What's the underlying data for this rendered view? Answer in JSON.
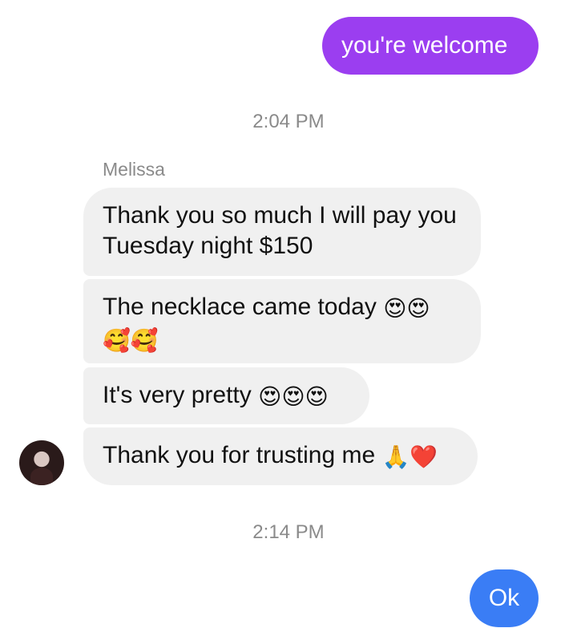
{
  "messages": {
    "sent_1": "you're welcome",
    "timestamp_1": "2:04 PM",
    "sender_name": "Melissa",
    "recv_1": "Thank you so much I will pay you Tuesday night $150",
    "recv_2_text": "The necklace came today",
    "recv_2_emoji_line1": "😍😍",
    "recv_2_emoji_line2": "🥰🥰",
    "recv_3_text": "It's very pretty",
    "recv_3_emoji": "😍😍😍",
    "recv_4_text": "Thank you for trusting me",
    "recv_4_emoji": "🙏❤️",
    "timestamp_2": "2:14 PM",
    "sent_2": "Ok"
  },
  "colors": {
    "sent_purple": "#9b3ef0",
    "sent_blue": "#3a7df5",
    "received_bubble": "#f0f0f0",
    "timestamp": "#8a8a8a"
  }
}
